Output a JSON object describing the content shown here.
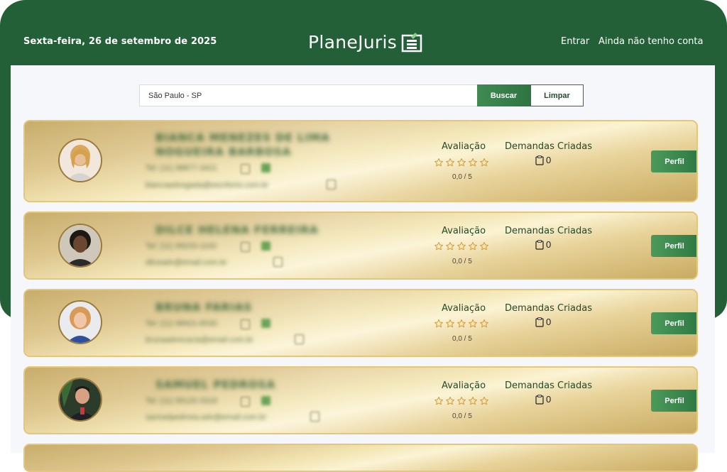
{
  "header": {
    "date": "Sexta-feira, 26 de setembro de 2025",
    "brand": "PlaneJuris",
    "login_label": "Entrar",
    "signup_label": "Ainda não tenho conta"
  },
  "search": {
    "value": "São Paulo - SP",
    "search_label": "Buscar",
    "clear_label": "Limpar"
  },
  "cards": [
    {
      "name_line1": "BIANCA MENEZES DE LIMA",
      "name_line2": "NOGUEIRA BARBOSA",
      "phone": "Tel: (11) 98877-3421",
      "email": "biancaadvogada@escritorio.com.br",
      "rating_label": "Avaliação",
      "score": "0,0 / 5",
      "demands_label": "Demandas Criadas",
      "demands_count": "0",
      "profile_label": "Perfil"
    },
    {
      "name_line1": "DILCE HELENA FERREIRA",
      "name_line2": "",
      "phone": "Tel: (11) 99233-1100",
      "email": "dilceadv@email.com.br",
      "rating_label": "Avaliação",
      "score": "0,0 / 5",
      "demands_label": "Demandas Criadas",
      "demands_count": "0",
      "profile_label": "Perfil"
    },
    {
      "name_line1": "BRUNA FARIAS",
      "name_line2": "",
      "phone": "Tel: (11) 98421-6530",
      "email": "brunaadvocacia@email.com.br",
      "rating_label": "Avaliação",
      "score": "0,0 / 5",
      "demands_label": "Demandas Criadas",
      "demands_count": "0",
      "profile_label": "Perfil"
    },
    {
      "name_line1": "SAMUEL PEDROSA",
      "name_line2": "",
      "phone": "Tel: (11) 99120-3318",
      "email": "samuelpedrosa.adv@email.com.br",
      "rating_label": "Avaliação",
      "score": "0,0 / 5",
      "demands_label": "Demandas Criadas",
      "demands_count": "0",
      "profile_label": "Perfil"
    }
  ]
}
